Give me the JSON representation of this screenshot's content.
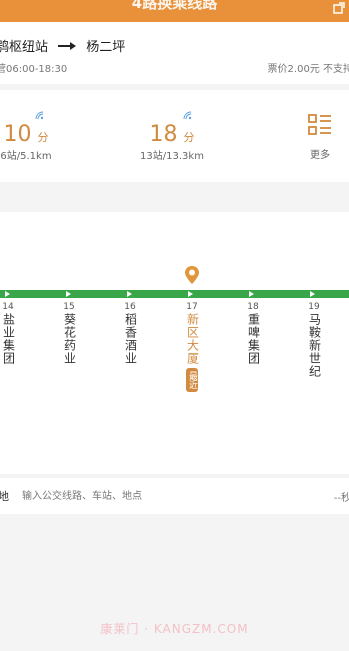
{
  "header": {
    "title": "4路换乘线路"
  },
  "route": {
    "origin": "鸮枢纽站",
    "destination": "杨二坪",
    "service_hours": "营06:00-18:30",
    "fare": "票价2.00元 不支持"
  },
  "eta": [
    {
      "minutes": "10",
      "unit": "分",
      "detail": "6站/5.1km"
    },
    {
      "minutes": "18",
      "unit": "分",
      "detail": "13站/13.3km"
    }
  ],
  "more": {
    "label": "更多"
  },
  "stations": [
    {
      "num": "14",
      "name": "盐业集团"
    },
    {
      "num": "15",
      "name": "葵花药业"
    },
    {
      "num": "16",
      "name": "稻香酒业"
    },
    {
      "num": "17",
      "name": "新区大厦",
      "current": true,
      "badge": "最近"
    },
    {
      "num": "18",
      "name": "重啤集团"
    },
    {
      "num": "19",
      "name": "马鞍新世纪"
    }
  ],
  "search": {
    "lead": "地",
    "placeholder": "输入公交线路、车站、地点",
    "right": "--秒"
  },
  "watermark": "康莱门 · KANGZM.COM",
  "colors": {
    "accent": "#e8913a",
    "track": "#3aa64a",
    "current": "#d18a3f"
  }
}
